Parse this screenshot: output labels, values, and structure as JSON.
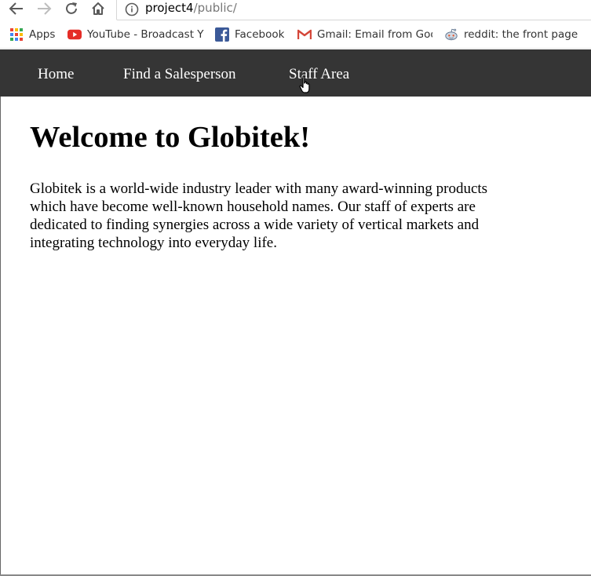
{
  "browser": {
    "address": {
      "host": "project4",
      "path": "/public/"
    },
    "bookmarks": [
      {
        "label": "Apps",
        "icon": "apps-grid-icon"
      },
      {
        "label": "YouTube - Broadcast Y",
        "icon": "youtube-icon"
      },
      {
        "label": "Facebook",
        "icon": "facebook-icon"
      },
      {
        "label": "Gmail: Email from Goo",
        "icon": "gmail-icon"
      },
      {
        "label": "reddit: the front page",
        "icon": "reddit-icon"
      }
    ]
  },
  "site": {
    "nav": [
      {
        "label": "Home"
      },
      {
        "label": "Find a Salesperson"
      },
      {
        "label": "Staff Area"
      }
    ],
    "heading": "Welcome to Globitek!",
    "intro_lines": [
      "Globitek is a world-wide industry leader with many award-winning products",
      "which have become well-known household names. Our staff of experts are",
      "dedicated to finding synergies across a wide variety of vertical markets and",
      "integrating technology into everyday life."
    ]
  },
  "colors": {
    "nav_bg": "#353535",
    "nav_text": "#ffffff",
    "youtube_red": "#e52d27",
    "facebook_blue": "#3b5998",
    "gmail_red": "#d44638"
  }
}
